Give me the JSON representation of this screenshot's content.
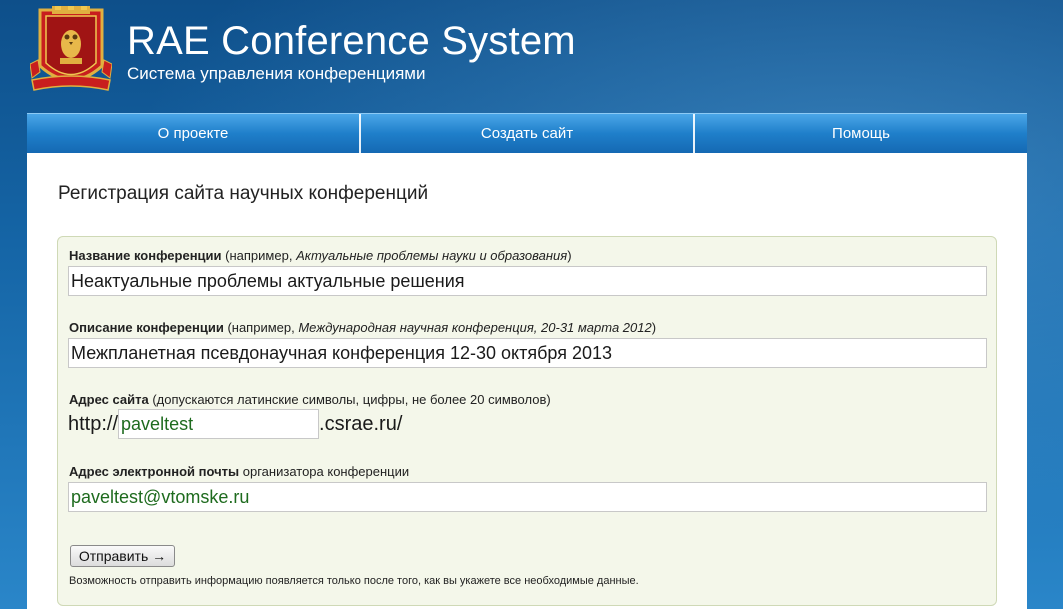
{
  "header": {
    "title": "RAE Conference System",
    "subtitle": "Система управления конференциями",
    "logo_icon": "coat-of-arms-icon"
  },
  "nav": {
    "items": [
      {
        "label": "О проекте"
      },
      {
        "label": "Создать сайт"
      },
      {
        "label": "Помощь"
      }
    ]
  },
  "page": {
    "title": "Регистрация сайта научных конференций"
  },
  "form": {
    "name": {
      "label_bold": "Название конференции",
      "hint_prefix": " (например, ",
      "hint_example": "Актуальные проблемы науки и образования",
      "hint_suffix": ")",
      "value": "Неактуальные проблемы актуальные решения"
    },
    "description": {
      "label_bold": "Описание конференции",
      "hint_prefix": " (например, ",
      "hint_example": "Международная научная конференция, 20-31 марта 2012",
      "hint_suffix": ")",
      "value": "Межпланетная псевдонаучная конференция 12-30 октября 2013"
    },
    "site": {
      "label_bold": "Адрес сайта",
      "hint": " (допускаются латинские символы, цифры, не более 20 символов)",
      "prefix": "http://",
      "value": "paveltest",
      "suffix": ".csrae.ru/"
    },
    "email": {
      "label_bold": "Адрес электронной почты",
      "hint": " организатора конференции",
      "value": "paveltest@vtomske.ru"
    },
    "submit_label": "Отправить →",
    "note": "Возможность отправить информацию появляется только после того, как вы укажете все необходимые данные."
  },
  "colors": {
    "nav": "#1f7fca",
    "form_bg": "#f4f7ea",
    "input_text_green": "#1e6b1e"
  }
}
